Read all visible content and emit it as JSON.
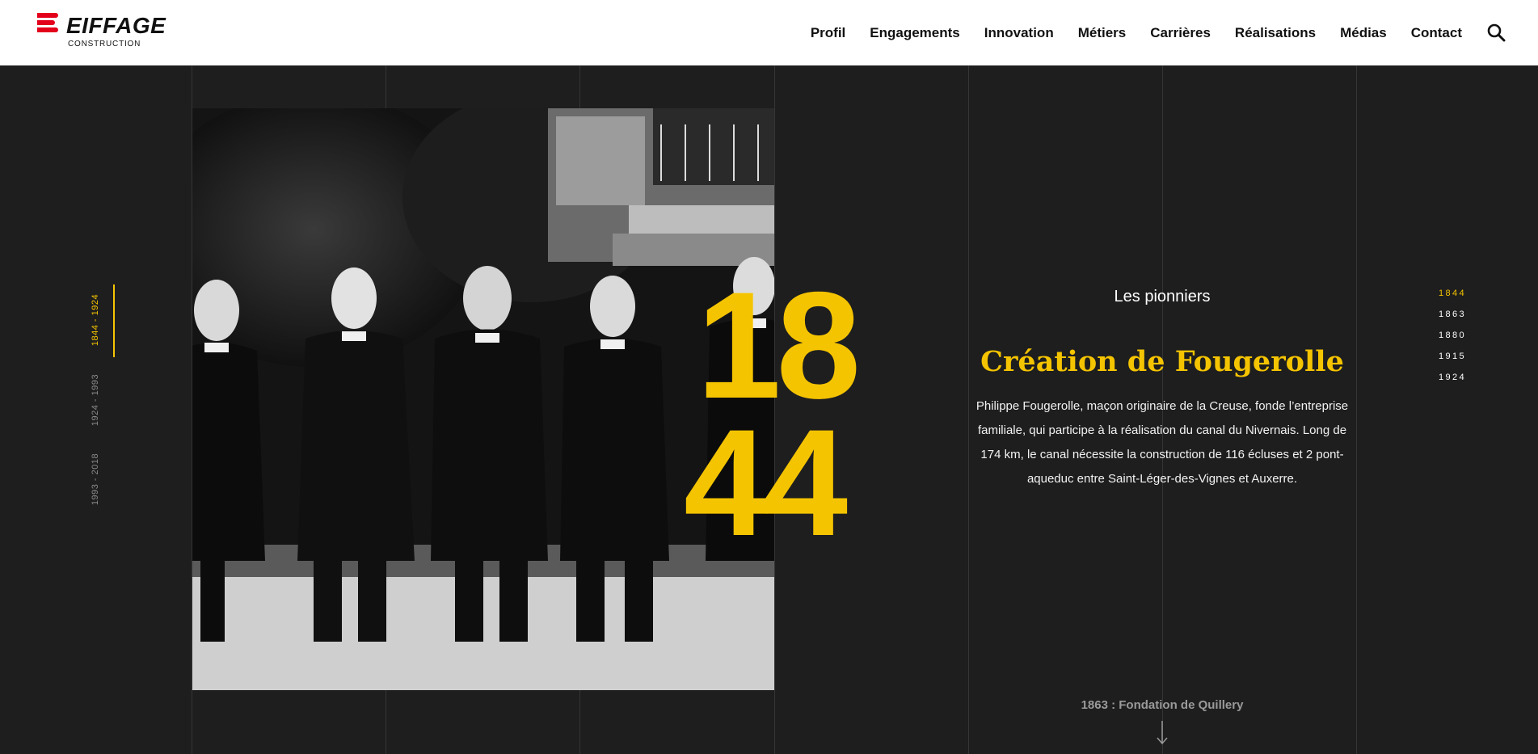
{
  "brand": {
    "name": "EIFFAGE",
    "subtitle": "CONSTRUCTION",
    "red": "#e3001b"
  },
  "nav": {
    "items": [
      "Profil",
      "Engagements",
      "Innovation",
      "Métiers",
      "Carrières",
      "Réalisations",
      "Médias",
      "Contact"
    ],
    "search_icon": "search-icon"
  },
  "colors": {
    "accent": "#f5c400",
    "background": "#1e1e1e",
    "header": "#ffffff"
  },
  "periods": {
    "items": [
      "1844 - 1924",
      "1924 - 1993",
      "1993 - 2018"
    ],
    "active": "1844 - 1924"
  },
  "timeline": {
    "section_title": "Les pionniers",
    "year_top": "18",
    "year_bottom": "44",
    "event_title": "Création de Fougerolle",
    "event_description": "Philippe Fougerolle, maçon originaire de la Creuse, fonde l’entreprise familiale, qui participe à la réalisation du canal du Nivernais. Long de 174 km, le canal nécessite la construction de 116 écluses et 2 pont-aqueduc entre Saint-Léger-des-Vignes et Auxerre.",
    "years": [
      "1844",
      "1863",
      "1880",
      "1915",
      "1924"
    ],
    "active_year": "1844",
    "next_label": "1863 : Fondation de Quillery",
    "next_icon": "arrow-down-icon"
  }
}
